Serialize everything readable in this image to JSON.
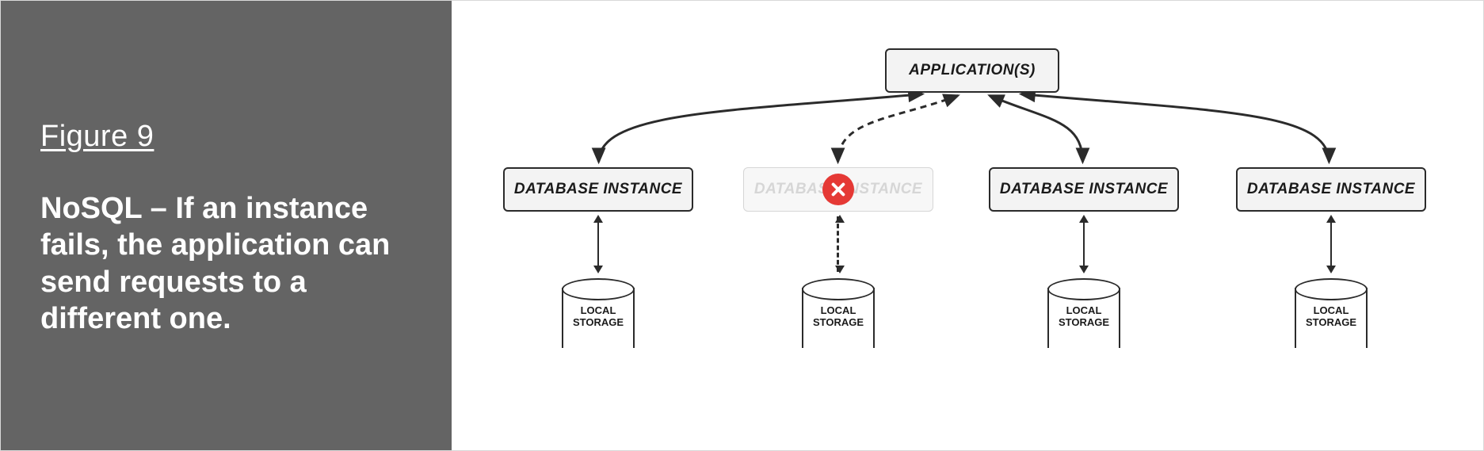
{
  "sidebar": {
    "figure_label": "Figure 9",
    "description": "NoSQL – If an instance fails, the application can send requests to a different one."
  },
  "diagram": {
    "application_label": "APPLICATION(S)",
    "instances": [
      {
        "label": "DATABASE INSTANCE",
        "status": "ok"
      },
      {
        "label": "DATABASE INSTANCE",
        "status": "failed"
      },
      {
        "label": "DATABASE INSTANCE",
        "status": "ok"
      },
      {
        "label": "DATABASE INSTANCE",
        "status": "ok"
      }
    ],
    "storage_label_line1": "LOCAL",
    "storage_label_line2": "STORAGE"
  }
}
